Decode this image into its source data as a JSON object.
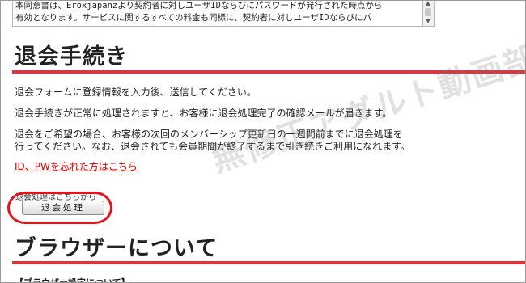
{
  "terms": {
    "line1": "本同意書は、Eroxjapanzより契約者に対しユーザIDならびにパスワードが発行された時点から",
    "line2": "有効となります。サービスに関するすべての料金も同様に、契約者に対しユーザIDならびにパ"
  },
  "withdraw_section": {
    "title": "退会手続き",
    "para1": "退会フォームに登録情報を入力後、送信してください。",
    "para2": "退会手続きが正常に処理されますと、お客様に退会処理完了の確認メールが届きます。",
    "para3_line1": "退会をご希望の場合、お客様の次回のメンバーシップ更新日の一週間前までに退会処理を",
    "para3_line2": "行ってください。なお、退会されても会員期間が終了するまで引き続きご利用になれます。",
    "forgot_link": "ID、PWを忘れた方はこちら",
    "button_caption": "退会処理はこちらから",
    "button_label": "退会処理"
  },
  "browser_section": {
    "title": "ブラウザーについて",
    "subheading": "【ブラウザー設定について】"
  },
  "watermark": "無修正アダルト動画部！",
  "colors": {
    "accent_rule": "#e8303a",
    "link": "#d40000",
    "highlight": "#e3141c"
  }
}
